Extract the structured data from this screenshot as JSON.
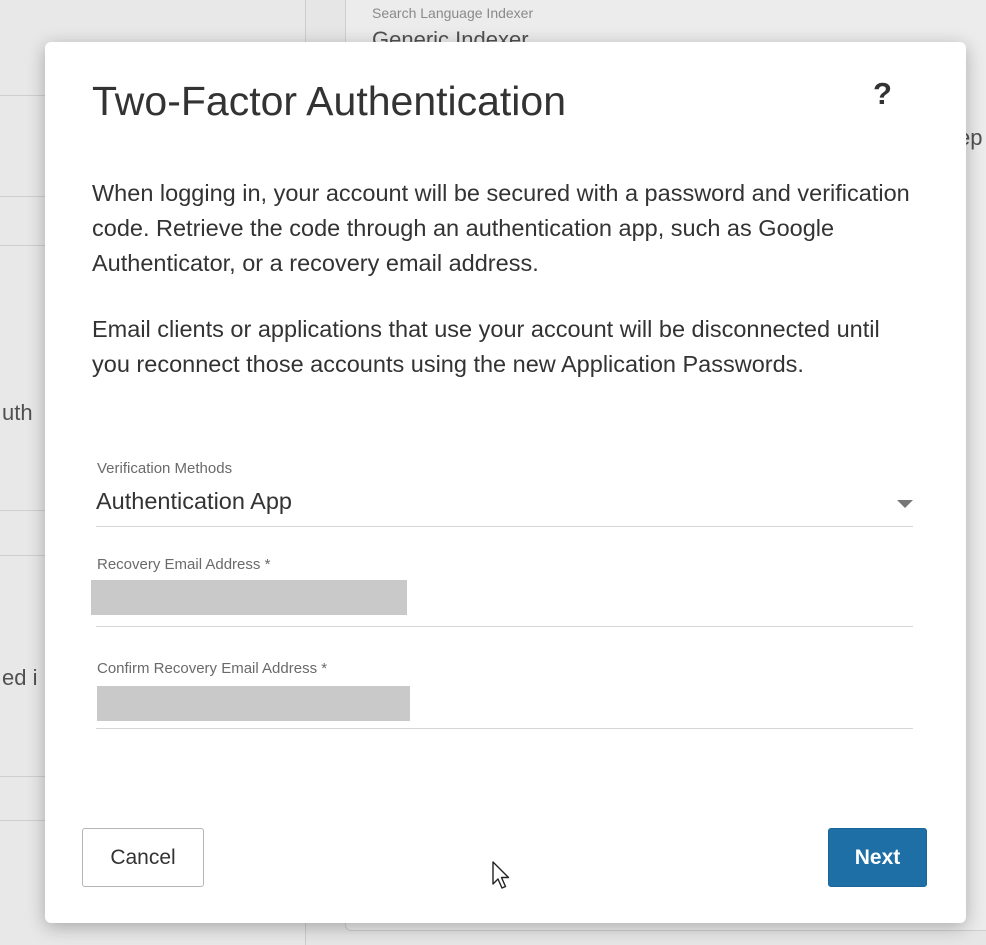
{
  "background": {
    "search_language_label": "Search Language Indexer",
    "search_language_value": "Generic Indexer",
    "clipped_right_text": "ep",
    "clipped_left_text_1": "uth",
    "clipped_left_text_2": "ed i"
  },
  "modal": {
    "title": "Two-Factor Authentication",
    "help_label": "?",
    "paragraph_1": "When logging in, your account will be secured with a password and verification code. Retrieve the code through an authentication app, such as Google Authenticator, or a recovery email address.",
    "paragraph_2": "Email clients or applications that use your account will be disconnected until you reconnect those accounts using the new Application Passwords.",
    "verification_methods": {
      "label": "Verification Methods",
      "selected": "Authentication App"
    },
    "recovery_email": {
      "label": "Recovery Email Address *",
      "value": ""
    },
    "confirm_recovery_email": {
      "label": "Confirm Recovery Email Address *",
      "value": ""
    },
    "cancel_label": "Cancel",
    "next_label": "Next"
  },
  "colors": {
    "primary_button": "#1d6fa5",
    "overlay_background": "#e6e6e6",
    "modal_background": "#ffffff"
  },
  "icons": {
    "select_arrow": "chevron-down-icon",
    "cursor": "mouse-pointer-icon"
  }
}
